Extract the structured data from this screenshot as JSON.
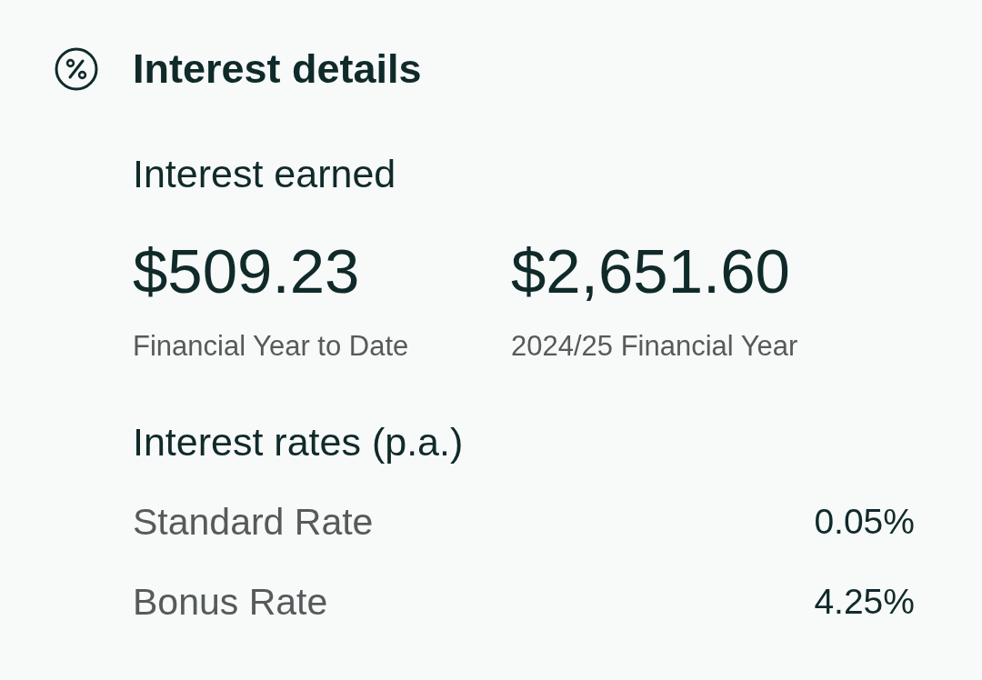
{
  "section": {
    "title": "Interest details"
  },
  "interest_earned": {
    "heading": "Interest earned",
    "amounts": [
      {
        "value": "$509.23",
        "label": "Financial Year to Date"
      },
      {
        "value": "$2,651.60",
        "label": "2024/25 Financial Year"
      }
    ]
  },
  "interest_rates": {
    "heading": "Interest rates (p.a.)",
    "rows": [
      {
        "label": "Standard Rate",
        "value": "0.05%"
      },
      {
        "label": "Bonus Rate",
        "value": "4.25%"
      }
    ]
  }
}
